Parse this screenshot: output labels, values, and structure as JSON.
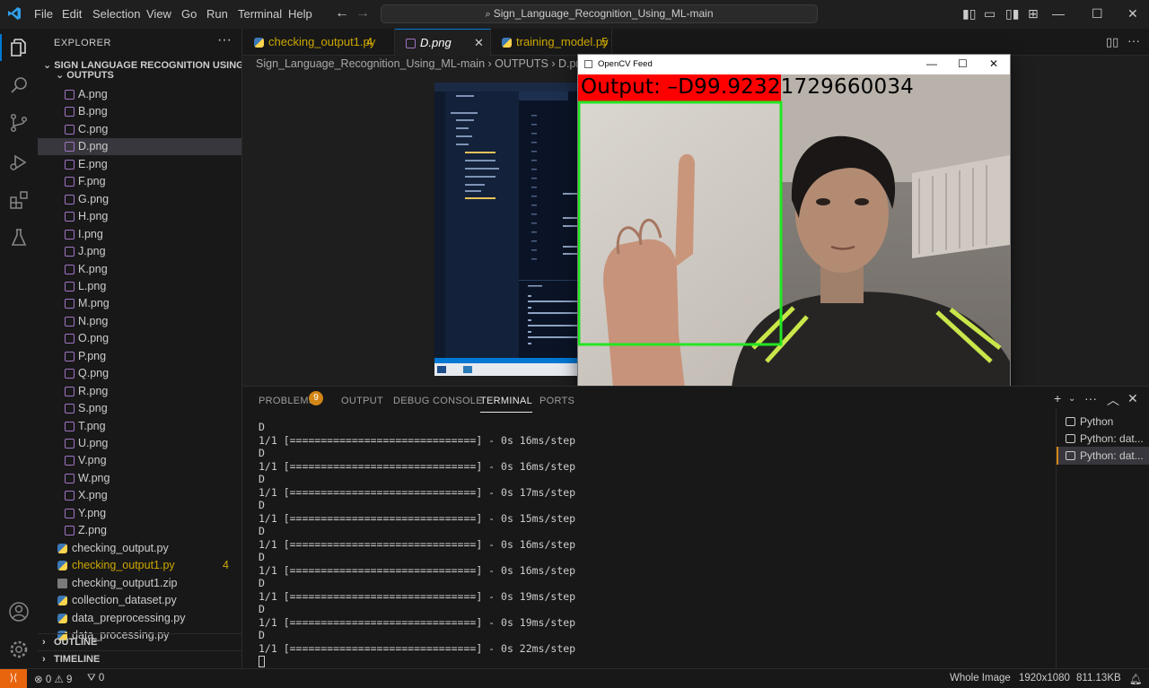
{
  "menu": [
    "File",
    "Edit",
    "Selection",
    "View",
    "Go",
    "Run",
    "Terminal",
    "Help"
  ],
  "search": "Sign_Language_Recognition_Using_ML-main",
  "sidebar": {
    "title": "EXPLORER",
    "root": "SIGN LANGUAGE RECOGNITION USING M...",
    "folder": "OUTPUTS",
    "png_files": [
      "A.png",
      "B.png",
      "C.png",
      "D.png",
      "E.png",
      "F.png",
      "G.png",
      "H.png",
      "I.png",
      "J.png",
      "K.png",
      "L.png",
      "M.png",
      "N.png",
      "O.png",
      "P.png",
      "Q.png",
      "R.png",
      "S.png",
      "T.png",
      "U.png",
      "V.png",
      "W.png",
      "X.png",
      "Y.png",
      "Z.png"
    ],
    "selected": "D.png",
    "other_files": [
      {
        "name": "checking_output.py",
        "type": "py",
        "color": "#cccccc",
        "badge": ""
      },
      {
        "name": "checking_output1.py",
        "type": "py",
        "color": "#cca700",
        "badge": "4"
      },
      {
        "name": "checking_output1.zip",
        "type": "zip",
        "color": "#cccccc",
        "badge": ""
      },
      {
        "name": "collection_dataset.py",
        "type": "py",
        "color": "#cccccc",
        "badge": ""
      },
      {
        "name": "data_preprocessing.py",
        "type": "py",
        "color": "#cccccc",
        "badge": ""
      },
      {
        "name": "data_processing.py",
        "type": "py",
        "color": "#cccccc",
        "badge": ""
      }
    ],
    "outline": "OUTLINE",
    "timeline": "TIMELINE"
  },
  "tabs": [
    {
      "label": "checking_output1.py",
      "badge": "4",
      "color": "#cca700"
    },
    {
      "label": "D.png",
      "badge": "",
      "color": "#ffffff"
    },
    {
      "label": "training_model.py",
      "badge": "5",
      "color": "#cca700"
    }
  ],
  "breadcrumb": "Sign_Language_Recognition_Using_ML-main  ›  OUTPUTS  ›  D.png",
  "opencv": {
    "title": "OpenCV Feed",
    "output": "Output:  –D99.92321729660034"
  },
  "panel": {
    "tabs": [
      "PROBLEMS",
      "OUTPUT",
      "DEBUG CONSOLE",
      "TERMINAL",
      "PORTS"
    ],
    "problems_count": "9",
    "active": "TERMINAL"
  },
  "terminal": {
    "lines": [
      "D",
      "1/1 [==============================] - 0s 16ms/step",
      "D",
      "1/1 [==============================] - 0s 16ms/step",
      "D",
      "1/1 [==============================] - 0s 17ms/step",
      "D",
      "1/1 [==============================] - 0s 15ms/step",
      "D",
      "1/1 [==============================] - 0s 16ms/step",
      "D",
      "1/1 [==============================] - 0s 16ms/step",
      "D",
      "1/1 [==============================] - 0s 19ms/step",
      "D",
      "1/1 [==============================] - 0s 19ms/step",
      "D",
      "1/1 [==============================] - 0s 22ms/step"
    ]
  },
  "terminal_list": [
    "Python",
    "Python: dat...",
    "Python: dat..."
  ],
  "status": {
    "errors": "0",
    "warnings": "9",
    "ports": "0",
    "view": "Whole Image",
    "dimensions": "1920x1080",
    "size": "811.13KB"
  },
  "colors": {
    "accent": "#0078d4",
    "warning": "#cca700",
    "badge": "#d18616",
    "output_banner": "#ff0000",
    "bbox": "#22e622"
  }
}
